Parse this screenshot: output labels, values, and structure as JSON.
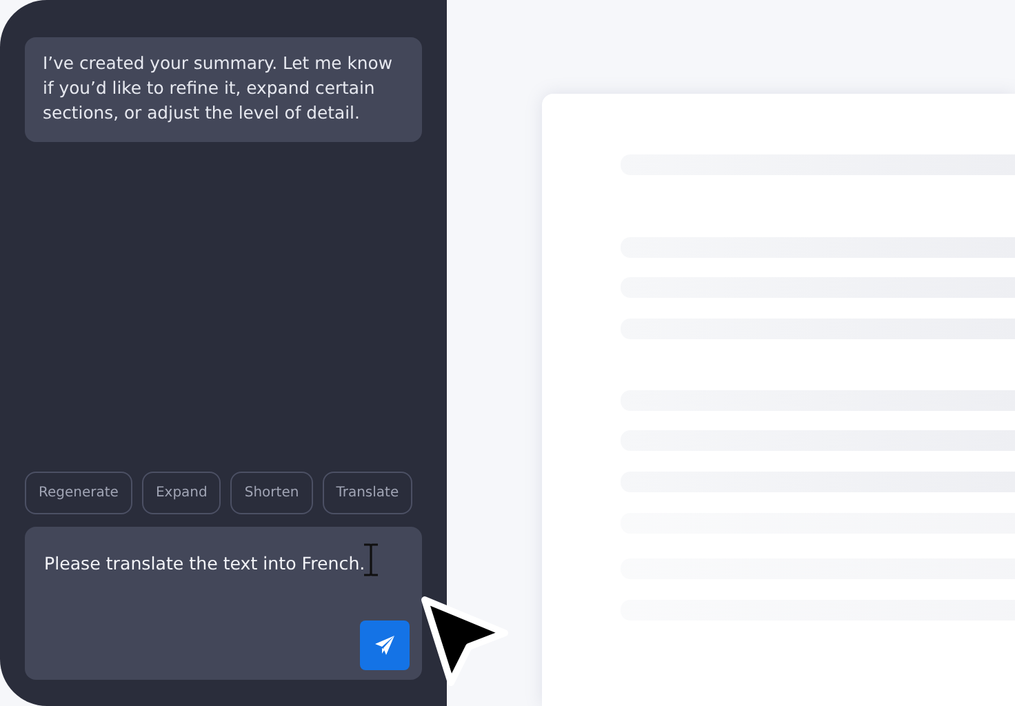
{
  "assistant_message": "I’ve created your summary. Let me know if you’d like to refine it, expand certain sections, or adjust the level of detail.",
  "actions": [
    {
      "label": "Regenerate"
    },
    {
      "label": "Expand"
    },
    {
      "label": "Shorten"
    },
    {
      "label": "Translate"
    }
  ],
  "composer": {
    "value": "Please translate the text into French."
  }
}
